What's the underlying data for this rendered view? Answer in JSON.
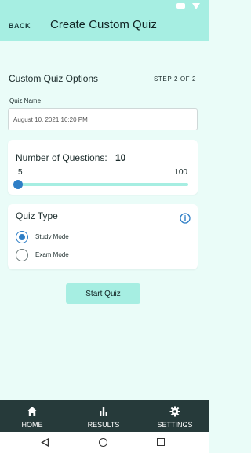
{
  "appbar": {
    "back_label": "BACK",
    "title": "Create Custom Quiz"
  },
  "options": {
    "title": "Custom Quiz Options",
    "step": "STEP 2 OF 2"
  },
  "quiz_name": {
    "label": "Quiz Name",
    "value": "August 10, 2021 10:20 PM"
  },
  "questions": {
    "label": "Number of Questions:",
    "value": "10",
    "min": "5",
    "max": "100",
    "slider_value": 10
  },
  "quiz_type": {
    "title": "Quiz Type",
    "options": [
      {
        "label": "Study Mode",
        "selected": true
      },
      {
        "label": "Exam Mode",
        "selected": false
      }
    ]
  },
  "start_button": "Start Quiz",
  "tabs": [
    {
      "label": "HOME",
      "icon": "home-icon"
    },
    {
      "label": "RESULTS",
      "icon": "bar-chart-icon"
    },
    {
      "label": "SETTINGS",
      "icon": "gear-icon"
    }
  ],
  "colors": {
    "accent": "#a6eee2",
    "primary": "#2e7ec6",
    "background": "#eafcf8",
    "tabbar": "#263a3a"
  }
}
